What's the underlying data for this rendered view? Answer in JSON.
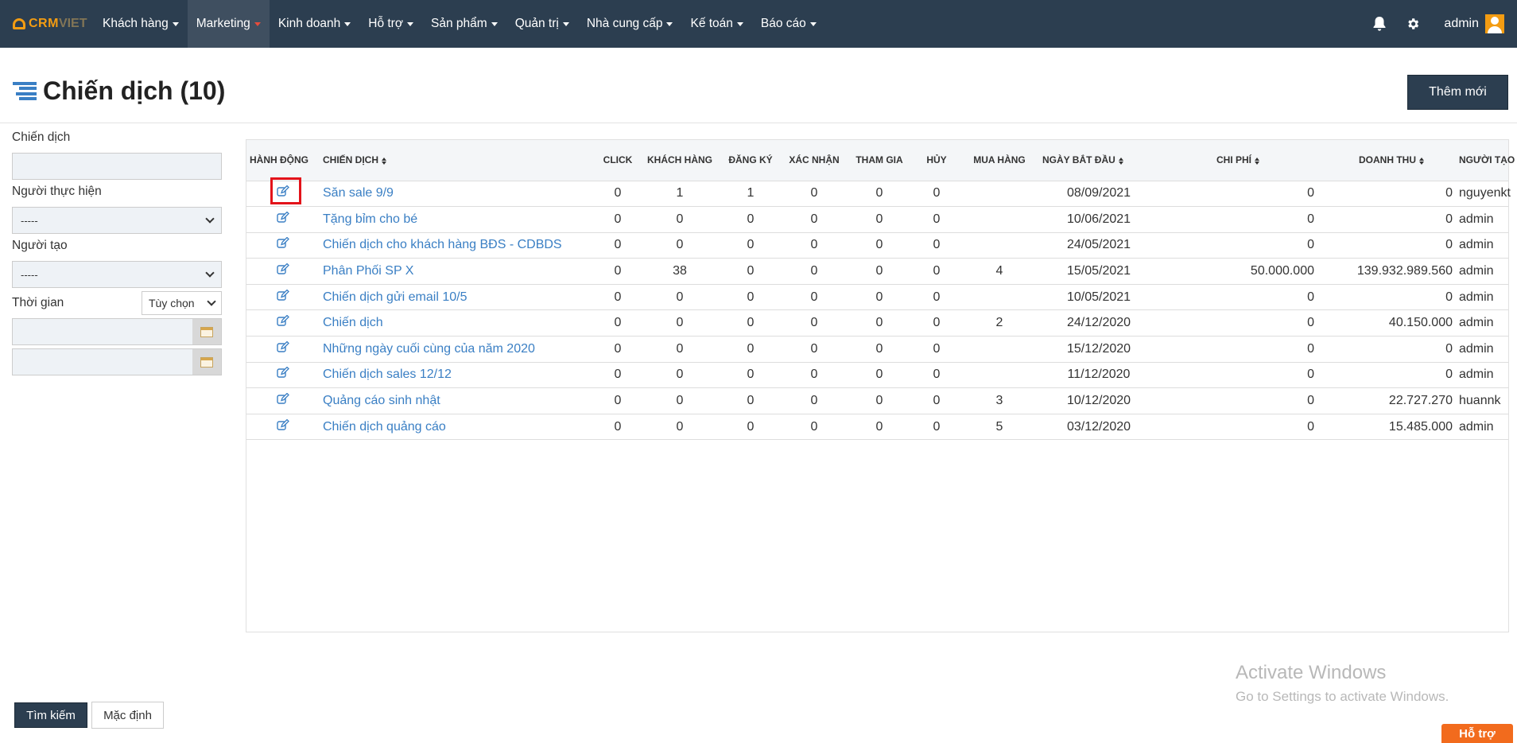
{
  "logo": {
    "crm": "CRM",
    "viet": "VIET"
  },
  "nav": {
    "items": [
      {
        "label": "Khách hàng",
        "active": false
      },
      {
        "label": "Marketing",
        "active": true
      },
      {
        "label": "Kinh doanh",
        "active": false
      },
      {
        "label": "Hỗ trợ",
        "active": false
      },
      {
        "label": "Sản phẩm",
        "active": false
      },
      {
        "label": "Quản trị",
        "active": false
      },
      {
        "label": "Nhà cung cấp",
        "active": false
      },
      {
        "label": "Kế toán",
        "active": false
      },
      {
        "label": "Báo cáo",
        "active": false
      }
    ],
    "user": "admin",
    "icons": [
      "bell-icon",
      "gear-icon"
    ]
  },
  "page": {
    "title": "Chiến dịch (10)",
    "add_button": "Thêm mới"
  },
  "filters": {
    "campaign_label": "Chiến dịch",
    "campaign_value": "",
    "assignee_label": "Người thực hiện",
    "assignee_value": "-----",
    "creator_label": "Người tạo",
    "creator_value": "-----",
    "time_label": "Thời gian",
    "time_value": "Tùy chọn",
    "date_from": "",
    "date_to": "",
    "search_button": "Tìm kiếm",
    "default_button": "Mặc định"
  },
  "table": {
    "headers": [
      "Hành động",
      "Chiến dịch",
      "Click",
      "Khách hàng",
      "Đăng ký",
      "Xác nhận",
      "Tham gia",
      "Hủy",
      "Mua hàng",
      "Ngày bắt đầu",
      "Chi phí",
      "Doanh thu",
      "Người tạo"
    ],
    "rows": [
      {
        "name": "Săn sale 9/9",
        "click": "0",
        "customers": "1",
        "registered": "1",
        "confirmed": "0",
        "joined": "0",
        "cancelled": "0",
        "purchased": "",
        "start": "08/09/2021",
        "cost": "0",
        "revenue": "0",
        "creator": "nguyenkt"
      },
      {
        "name": "Tặng bỉm cho bé",
        "click": "0",
        "customers": "0",
        "registered": "0",
        "confirmed": "0",
        "joined": "0",
        "cancelled": "0",
        "purchased": "",
        "start": "10/06/2021",
        "cost": "0",
        "revenue": "0",
        "creator": "admin"
      },
      {
        "name": "Chiến dịch cho khách hàng BĐS - CDBDS",
        "click": "0",
        "customers": "0",
        "registered": "0",
        "confirmed": "0",
        "joined": "0",
        "cancelled": "0",
        "purchased": "",
        "start": "24/05/2021",
        "cost": "0",
        "revenue": "0",
        "creator": "admin"
      },
      {
        "name": "Phân Phối SP X",
        "click": "0",
        "customers": "38",
        "registered": "0",
        "confirmed": "0",
        "joined": "0",
        "cancelled": "0",
        "purchased": "4",
        "start": "15/05/2021",
        "cost": "50.000.000",
        "revenue": "139.932.989.560",
        "creator": "admin"
      },
      {
        "name": "Chiến dịch gửi email 10/5",
        "click": "0",
        "customers": "0",
        "registered": "0",
        "confirmed": "0",
        "joined": "0",
        "cancelled": "0",
        "purchased": "",
        "start": "10/05/2021",
        "cost": "0",
        "revenue": "0",
        "creator": "admin"
      },
      {
        "name": "Chiến dịch",
        "click": "0",
        "customers": "0",
        "registered": "0",
        "confirmed": "0",
        "joined": "0",
        "cancelled": "0",
        "purchased": "2",
        "start": "24/12/2020",
        "cost": "0",
        "revenue": "40.150.000",
        "creator": "admin"
      },
      {
        "name": "Những ngày cuối cùng của năm 2020",
        "click": "0",
        "customers": "0",
        "registered": "0",
        "confirmed": "0",
        "joined": "0",
        "cancelled": "0",
        "purchased": "",
        "start": "15/12/2020",
        "cost": "0",
        "revenue": "0",
        "creator": "admin"
      },
      {
        "name": "Chiến dịch sales 12/12",
        "click": "0",
        "customers": "0",
        "registered": "0",
        "confirmed": "0",
        "joined": "0",
        "cancelled": "0",
        "purchased": "",
        "start": "11/12/2020",
        "cost": "0",
        "revenue": "0",
        "creator": "admin"
      },
      {
        "name": "Quảng cáo sinh nhật",
        "click": "0",
        "customers": "0",
        "registered": "0",
        "confirmed": "0",
        "joined": "0",
        "cancelled": "0",
        "purchased": "3",
        "start": "10/12/2020",
        "cost": "0",
        "revenue": "22.727.270",
        "creator": "huannk"
      },
      {
        "name": "Chiến dịch quảng cáo",
        "click": "0",
        "customers": "0",
        "registered": "0",
        "confirmed": "0",
        "joined": "0",
        "cancelled": "0",
        "purchased": "5",
        "start": "03/12/2020",
        "cost": "0",
        "revenue": "15.485.000",
        "creator": "admin"
      }
    ]
  },
  "overlay": {
    "watermark_title": "Activate Windows",
    "watermark_sub": "Go to Settings to activate Windows.",
    "help_button": "Hỗ trợ"
  },
  "colors": {
    "nav_bg": "#2c3e50",
    "brand": "#f39c12",
    "link": "#3a7fc4",
    "highlight": "#e3131a",
    "help": "#f26b1d"
  }
}
